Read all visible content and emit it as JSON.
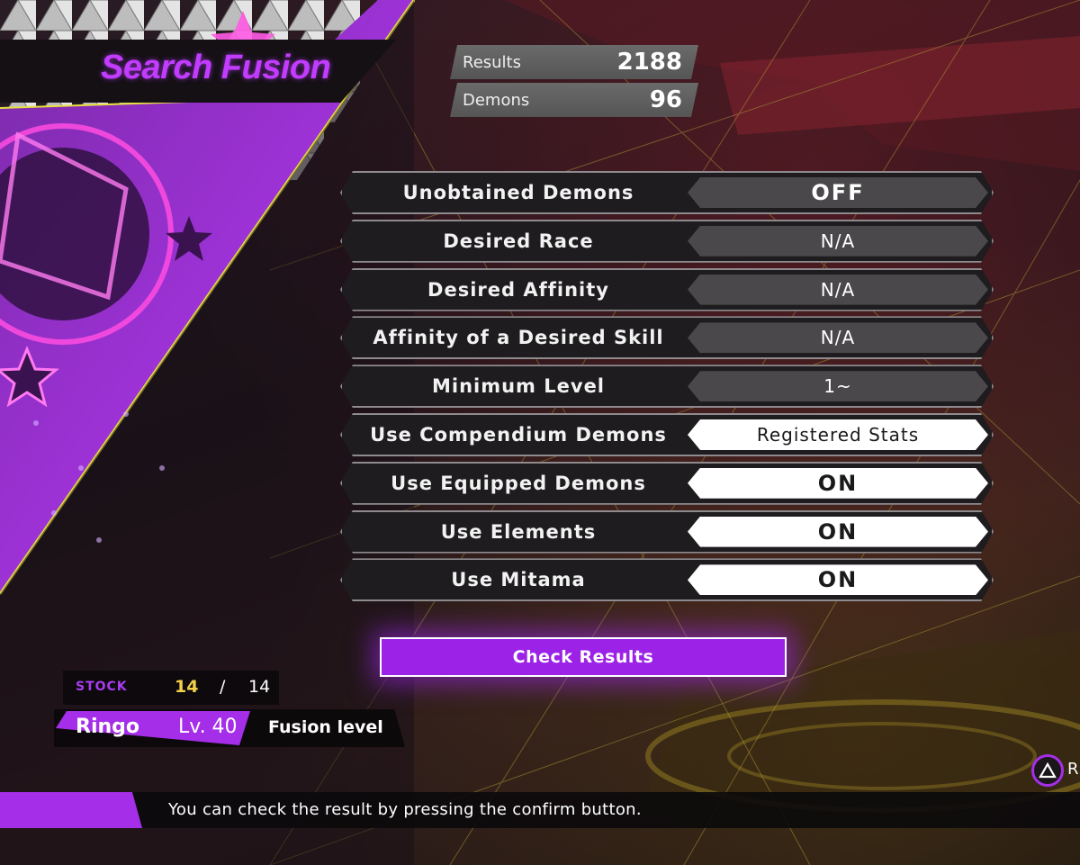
{
  "header": {
    "title": "Search Fusion"
  },
  "counts": {
    "results_label": "Results",
    "results_value": "2188",
    "demons_label": "Demons",
    "demons_value": "96"
  },
  "settings": [
    {
      "label": "Unobtained Demons",
      "value": "OFF"
    },
    {
      "label": "Desired Race",
      "value": "N/A"
    },
    {
      "label": "Desired Affinity",
      "value": "N/A"
    },
    {
      "label": "Affinity of a Desired Skill",
      "value": "N/A"
    },
    {
      "label": "Minimum Level",
      "value": "1~"
    },
    {
      "label": "Use Compendium Demons",
      "value": "Registered Stats"
    },
    {
      "label": "Use Equipped Demons",
      "value": "ON"
    },
    {
      "label": "Use Elements",
      "value": "ON"
    },
    {
      "label": "Use Mitama",
      "value": "ON"
    }
  ],
  "actions": {
    "check_results": "Check Results"
  },
  "stock": {
    "label": "STOCK",
    "current": "14",
    "separator": "/",
    "max": "14"
  },
  "character": {
    "name": "Ringo",
    "level": "Lv. 40",
    "fusion_level_label": "Fusion level"
  },
  "footer": {
    "message": "You can check the result by pressing the confirm button.",
    "triangle_button_label": "R"
  },
  "colors": {
    "accent": "#a52ee8",
    "title": "#c23cff",
    "stock_current": "#f2d04a"
  },
  "icons": {
    "triangle_button": "triangle-button-icon"
  }
}
